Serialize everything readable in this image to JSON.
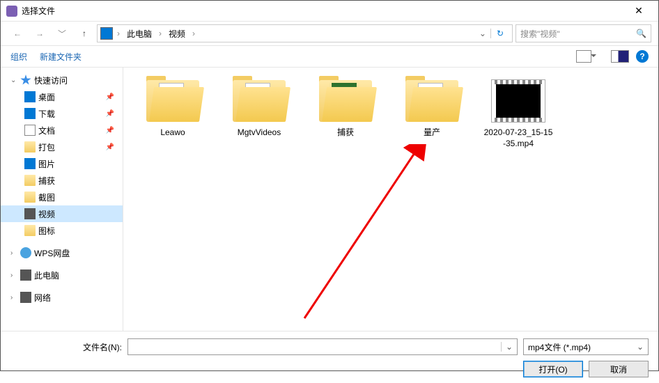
{
  "window": {
    "title": "选择文件"
  },
  "breadcrumb": {
    "root": "此电脑",
    "current": "视频"
  },
  "search": {
    "placeholder": "搜索\"视频\""
  },
  "toolbar": {
    "organize": "组织",
    "newfolder": "新建文件夹",
    "help": "?"
  },
  "sidebar": {
    "quick": "快速访问",
    "desktop": "桌面",
    "downloads": "下载",
    "documents": "文档",
    "package": "打包",
    "pictures": "图片",
    "capture": "捕获",
    "screenshot": "截图",
    "video": "视频",
    "icons": "图标",
    "wps": "WPS网盘",
    "thispc": "此电脑",
    "network": "网络"
  },
  "items": {
    "i0": "Leawo",
    "i1": "MgtvVideos",
    "i2": "捕获",
    "i3": "量产",
    "i4": "2020-07-23_15-15-35.mp4"
  },
  "bottom": {
    "filename_label": "文件名(N):",
    "filter": "mp4文件 (*.mp4)",
    "open": "打开(O)",
    "cancel": "取消"
  }
}
